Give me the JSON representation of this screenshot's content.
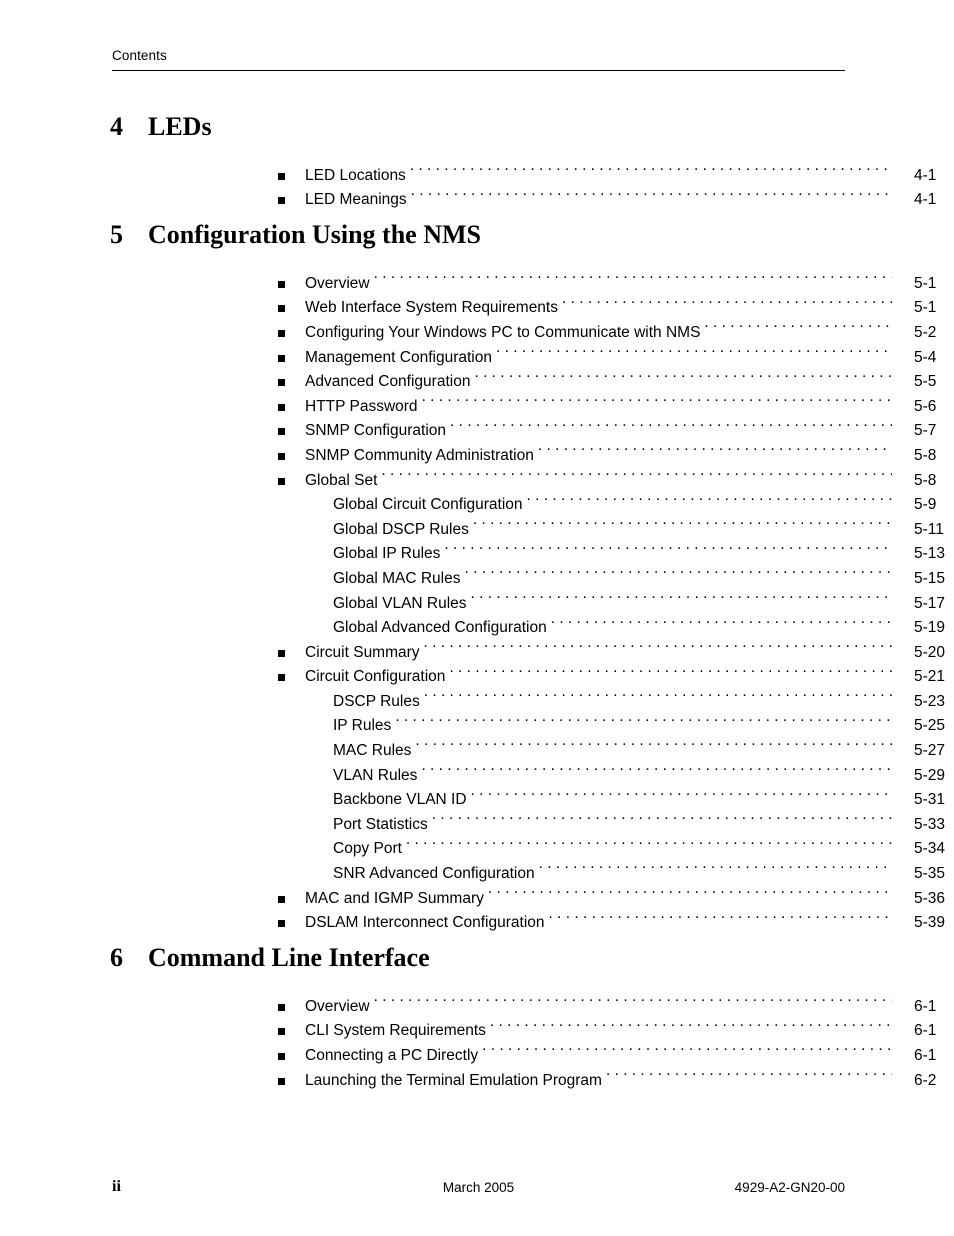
{
  "header": {
    "label": "Contents"
  },
  "chapters": [
    {
      "number": "4",
      "title": "LEDs",
      "entries": [
        {
          "level": 1,
          "label": "LED Locations",
          "page": "4-1"
        },
        {
          "level": 1,
          "label": "LED Meanings",
          "page": "4-1"
        }
      ]
    },
    {
      "number": "5",
      "title": "Configuration Using the NMS",
      "entries": [
        {
          "level": 1,
          "label": "Overview",
          "page": "5-1"
        },
        {
          "level": 1,
          "label": "Web Interface System Requirements",
          "page": "5-1"
        },
        {
          "level": 1,
          "label": "Configuring Your Windows PC to Communicate with NMS",
          "page": "5-2"
        },
        {
          "level": 1,
          "label": "Management Configuration",
          "page": "5-4"
        },
        {
          "level": 1,
          "label": "Advanced Configuration",
          "page": "5-5"
        },
        {
          "level": 1,
          "label": "HTTP Password",
          "page": "5-6"
        },
        {
          "level": 1,
          "label": "SNMP Configuration",
          "page": "5-7"
        },
        {
          "level": 1,
          "label": "SNMP Community Administration",
          "page": "5-8"
        },
        {
          "level": 1,
          "label": "Global Set",
          "page": "5-8"
        },
        {
          "level": 2,
          "label": "Global Circuit Configuration",
          "page": "5-9"
        },
        {
          "level": 2,
          "label": "Global DSCP Rules",
          "page": "5-11"
        },
        {
          "level": 2,
          "label": "Global IP Rules",
          "page": "5-13"
        },
        {
          "level": 2,
          "label": "Global MAC Rules",
          "page": "5-15"
        },
        {
          "level": 2,
          "label": "Global VLAN Rules",
          "page": "5-17"
        },
        {
          "level": 2,
          "label": "Global Advanced Configuration",
          "page": "5-19"
        },
        {
          "level": 1,
          "label": "Circuit Summary",
          "page": "5-20"
        },
        {
          "level": 1,
          "label": "Circuit Configuration",
          "page": "5-21"
        },
        {
          "level": 2,
          "label": "DSCP Rules",
          "page": "5-23"
        },
        {
          "level": 2,
          "label": "IP Rules",
          "page": "5-25"
        },
        {
          "level": 2,
          "label": "MAC Rules",
          "page": "5-27"
        },
        {
          "level": 2,
          "label": "VLAN Rules",
          "page": "5-29"
        },
        {
          "level": 2,
          "label": "Backbone VLAN ID",
          "page": "5-31"
        },
        {
          "level": 2,
          "label": "Port Statistics",
          "page": "5-33"
        },
        {
          "level": 2,
          "label": "Copy Port",
          "page": "5-34"
        },
        {
          "level": 2,
          "label": "SNR Advanced Configuration",
          "page": "5-35"
        },
        {
          "level": 1,
          "label": "MAC and IGMP Summary",
          "page": "5-36"
        },
        {
          "level": 1,
          "label": "DSLAM Interconnect Configuration",
          "page": "5-39"
        }
      ]
    },
    {
      "number": "6",
      "title": "Command Line Interface",
      "entries": [
        {
          "level": 1,
          "label": "Overview",
          "page": "6-1"
        },
        {
          "level": 1,
          "label": "CLI System Requirements",
          "page": "6-1"
        },
        {
          "level": 1,
          "label": "Connecting a PC Directly",
          "page": "6-1"
        },
        {
          "level": 1,
          "label": "Launching the Terminal Emulation Program",
          "page": "6-2"
        }
      ]
    }
  ],
  "footer": {
    "page_number": "ii",
    "date": "March 2005",
    "document_number": "4929-A2-GN20-00"
  }
}
